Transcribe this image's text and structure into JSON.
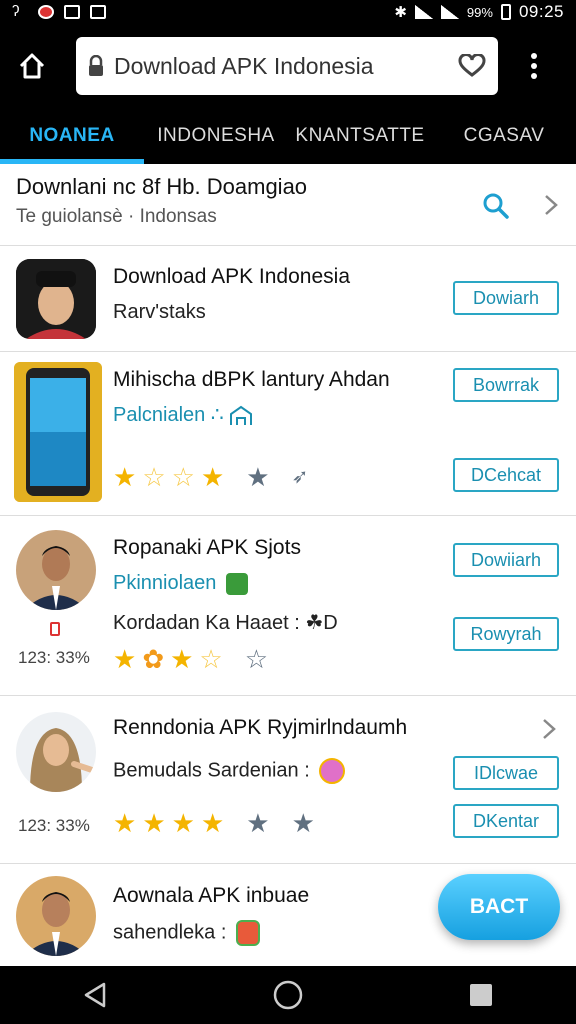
{
  "status_bar": {
    "battery_pct": "99%",
    "time": "09:25"
  },
  "browser": {
    "url_text": "Download APK Indonesia"
  },
  "tabs": [
    {
      "label": "NOANEA",
      "active": true
    },
    {
      "label": "INDONESHA",
      "active": false
    },
    {
      "label": "KNANTSATTE",
      "active": false
    },
    {
      "label": "CGASAV",
      "active": false
    }
  ],
  "header": {
    "title": "Downlani nc 8f Hb. Doamgiao",
    "subtitle": "Te guiolansè · Indonsas"
  },
  "rows": [
    {
      "title": "Download APK Indonesia",
      "line1": "Rarv'staks",
      "button": "Dowiarh"
    },
    {
      "title": "Mihischa dBPK  lantury Ahdan",
      "line1": "Palcnialen ∴",
      "button_top": "Bowrrak",
      "button_bottom": "DCehcat",
      "rating": 4
    },
    {
      "title": "Ropanaki APK Sjots",
      "line1": "Pkinniolaen",
      "line2": "Kordadan Ka  Haaet : ☘D",
      "count": "123: 33%",
      "button_top": "Dowiiarh",
      "button_bottom": "Rowyrah",
      "rating": 4
    },
    {
      "title": "Renndonia APK Ryjmirlndaumh",
      "line1": "Bemudals Sardenian :",
      "count": "123: 33%",
      "button_top": "IDlcwae",
      "button_bottom": "DKentar",
      "rating": 4
    },
    {
      "title": "Aownala APK inbuae",
      "line1": "sahendleka :"
    }
  ],
  "fab": {
    "label": "BACT"
  },
  "colors": {
    "accent": "#29b6f6",
    "button_border": "#2aa6c4",
    "star": "#f4b400"
  }
}
